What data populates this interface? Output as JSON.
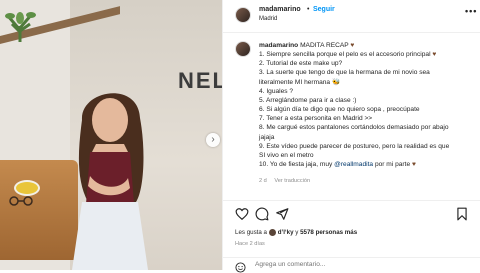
{
  "header": {
    "username": "madamarino",
    "dot": "•",
    "follow_label": "Seguir",
    "location": "Madrid",
    "more_icon": "more-horizontal-icon"
  },
  "photo": {
    "sign_text": "NEL",
    "next_icon": "chevron-right-icon",
    "next_glyph": "›"
  },
  "caption": {
    "username": "madamarino",
    "title": "MADITA RECAP",
    "lines": [
      "1. Siempre sencilla porque el pelo es el accesorio principal",
      "2. Tutorial de este make up?",
      "3. La suerte que tengo de que la hermana de mi novio sea",
      "literalmente MI hermana",
      "4. Iguales ?",
      "5. Arreglándome para ir a clase :)",
      "6. Si algún día te digo que no quiero sopa , preocúpate",
      "7. Tener a esta personita en Madrid >>",
      "8. Me cargué estos pantalones cortándolos demasiado por abajo",
      "jajaja",
      "9. Este vídeo puede parecer de postureo, pero la realidad es que",
      "SI vivo en el metro",
      "10. Yo de fiesta jaja, muy "
    ],
    "mention": "@reallmadita",
    "last_suffix": " por mi parte ",
    "meta_time": "2 d",
    "translate_label": "Ver traducción"
  },
  "actions": {
    "like_icon": "heart-icon",
    "comment_icon": "comment-icon",
    "share_icon": "send-icon",
    "save_icon": "bookmark-icon"
  },
  "likes": {
    "prefix": "Les gusta a ",
    "user": "d’l‘ky",
    "count_text": "5578 personas más"
  },
  "time_ago": "Hace 2 días",
  "comment": {
    "placeholder": "Agrega un comentario...",
    "emoji_icon": "emoji-icon"
  },
  "colors": {
    "accent": "#0095f6",
    "mention": "#00376b",
    "secondary_text": "#8e8e8e"
  }
}
